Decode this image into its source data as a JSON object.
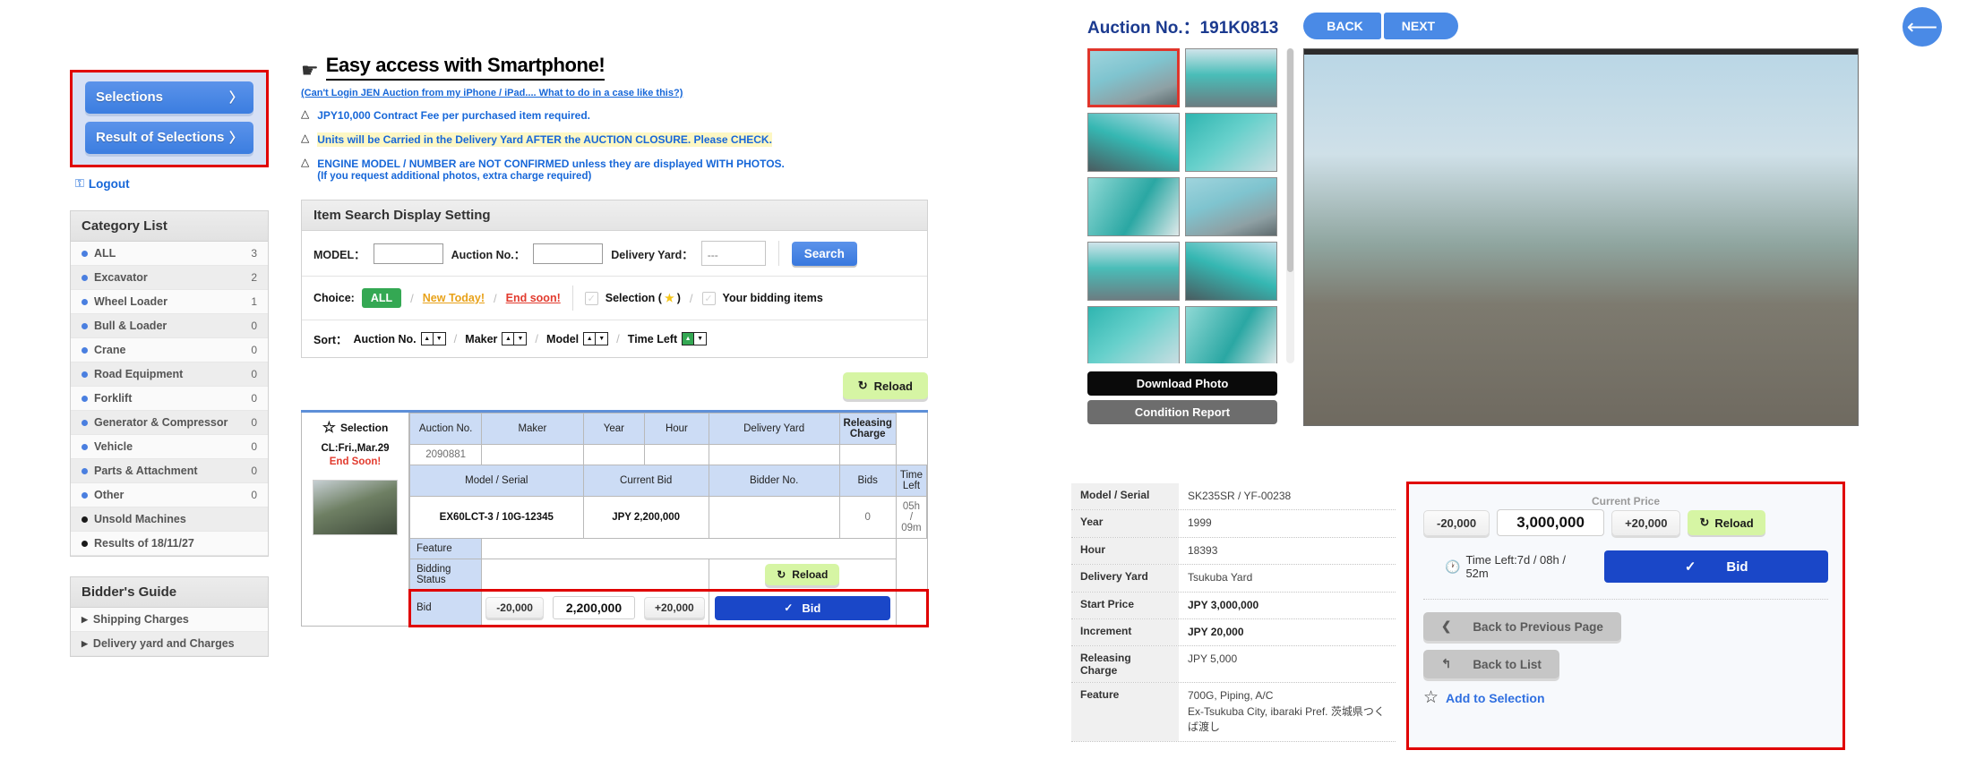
{
  "sidebar": {
    "selections_label": "Selections",
    "result_label": "Result of Selections",
    "chevron": "〉",
    "logout_label": "Logout",
    "category": {
      "title": "Category List",
      "items": [
        {
          "label": "ALL",
          "count": "3",
          "dark": false
        },
        {
          "label": "Excavator",
          "count": "2",
          "dark": false
        },
        {
          "label": "Wheel Loader",
          "count": "1",
          "dark": false
        },
        {
          "label": "Bull & Loader",
          "count": "0",
          "dark": false
        },
        {
          "label": "Crane",
          "count": "0",
          "dark": false
        },
        {
          "label": "Road Equipment",
          "count": "0",
          "dark": false
        },
        {
          "label": "Forklift",
          "count": "0",
          "dark": false
        },
        {
          "label": "Generator & Compressor",
          "count": "0",
          "dark": false
        },
        {
          "label": "Vehicle",
          "count": "0",
          "dark": false
        },
        {
          "label": "Parts & Attachment",
          "count": "0",
          "dark": false
        },
        {
          "label": "Other",
          "count": "0",
          "dark": false
        },
        {
          "label": "Unsold Machines",
          "count": "",
          "dark": true
        },
        {
          "label": "Results of 18/11/27",
          "count": "",
          "dark": true
        }
      ]
    },
    "guide": {
      "title": "Bidder's Guide",
      "items": [
        {
          "label": "Shipping Charges"
        },
        {
          "label": "Delivery yard and Charges"
        }
      ]
    }
  },
  "center": {
    "smartphone_title": "Easy access with Smartphone!",
    "smartphone_sub": "(Can't Login JEN Auction from my iPhone / iPad.... What to do in a case like this?)",
    "notices": [
      {
        "text": "JPY10,000 Contract Fee per purchased item required.",
        "highlight": false
      },
      {
        "text": "Units will be Carried in the Delivery Yard AFTER the AUCTION CLOSURE. Please CHECK.",
        "highlight": true
      },
      {
        "text": "ENGINE MODEL / NUMBER are NOT CONFIRMED unless they are displayed WITH PHOTOS.",
        "highlight": false
      },
      {
        "text": "(If you request additional photos, extra charge required)",
        "highlight": false
      }
    ],
    "search_panel": {
      "title": "Item Search Display Setting",
      "model_label": "MODEL：",
      "model_value": "",
      "auction_no_label": "Auction No.：",
      "auction_no_value": "",
      "delivery_yard_label": "Delivery Yard：",
      "delivery_yard_value": "---",
      "search_button": "Search",
      "choice_label": "Choice:",
      "choice_all": "ALL",
      "choice_new": "New Today!",
      "choice_end": "End soon!",
      "selection_checkbox": "Selection (",
      "selection_checkbox_end": ")",
      "bidding_checkbox": "Your bidding items",
      "sort_label": "Sort：",
      "sort_options": [
        "Auction No.",
        "Maker",
        "Model",
        "Time Left"
      ],
      "active_sort": "Time Left"
    },
    "reload_label": "Reload",
    "listing": {
      "selection_label": "Selection",
      "cl_text": "CL:Fri.,Mar.29",
      "end_soon": "End Soon!",
      "headers_row1": [
        "Auction No.",
        "Maker",
        "Year",
        "Hour",
        "Delivery Yard",
        "Releasing Charge"
      ],
      "values_row1": [
        "2090881",
        "",
        "",
        "",
        "",
        ""
      ],
      "headers_row2": [
        "Model / Serial",
        "Current Bid",
        "Bidder No.",
        "Bids",
        "Time Left"
      ],
      "values_row2": [
        "EX60LCT-3 / 10G-12345",
        "JPY 2,200,000",
        "",
        "0",
        "05h / 09m"
      ],
      "feature_label": "Feature",
      "feature_value": "",
      "bidding_status_label": "Bidding Status",
      "bidding_status_value": "",
      "bid_label": "Bid",
      "minus_label": "-20,000",
      "bid_amount": "2,200,000",
      "plus_label": "+20,000",
      "bid_button": "Bid",
      "reload_label": "Reload"
    }
  },
  "detail": {
    "auction_no_label": "Auction No.：191K0813",
    "back_button": "BACK",
    "next_button": "NEXT",
    "download_photo": "Download Photo",
    "condition_report": "Condition Report",
    "spec": [
      {
        "key": "Model / Serial",
        "value": "SK235SR / YF-00238",
        "bold": false
      },
      {
        "key": "Year",
        "value": "1999",
        "bold": false
      },
      {
        "key": "Hour",
        "value": "18393",
        "bold": false
      },
      {
        "key": "Delivery Yard",
        "value": "Tsukuba Yard",
        "bold": false
      },
      {
        "key": "Start Price",
        "value": "JPY 3,000,000",
        "bold": true
      },
      {
        "key": "Increment",
        "value": "JPY 20,000",
        "bold": true
      },
      {
        "key": "Releasing Charge",
        "value": "JPY 5,000",
        "bold": false
      },
      {
        "key": "Feature",
        "value": "700G, Piping, A/C\nEx-Tsukuba City, ibaraki Pref. 茨城県つくば渡し",
        "bold": false
      }
    ],
    "bidpanel": {
      "current_price_label": "Current Price",
      "minus_label": "-20,000",
      "current_price": "3,000,000",
      "plus_label": "+20,000",
      "reload_label": "Reload",
      "time_left": "Time Left:7d / 08h / 52m",
      "bid_button": "Bid",
      "back_prev": "Back to Previous Page",
      "back_list": "Back to List",
      "add_selection": "Add to Selection"
    }
  },
  "colors": {
    "accent_blue": "#4a8ae6",
    "bid_blue": "#1a47c8",
    "alert_red": "#e00000",
    "green": "#34a853",
    "reload_green": "#d6f5a4"
  }
}
